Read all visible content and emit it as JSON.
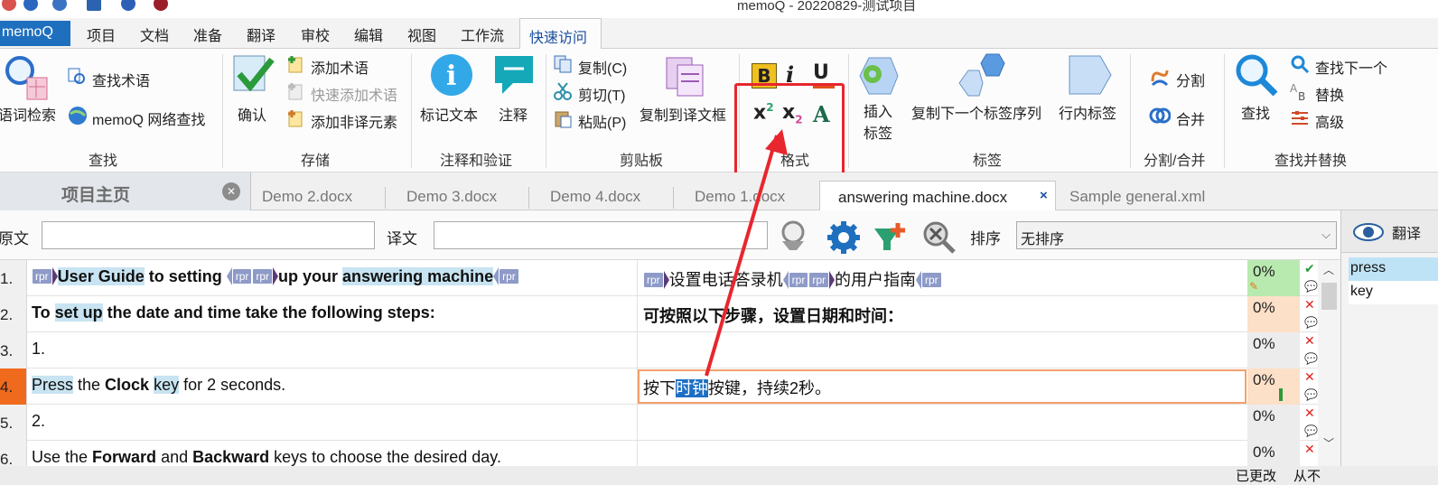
{
  "window": {
    "title": "memoQ - 20220829-测试项目"
  },
  "menu": {
    "app_button": "memoQ",
    "items": [
      "项目",
      "文档",
      "准备",
      "翻译",
      "审校",
      "编辑",
      "视图",
      "工作流"
    ],
    "active": "快速访问"
  },
  "ribbon": {
    "find": {
      "group": "查找",
      "term_search": "语词检索",
      "find_term": "查找术语",
      "web_search": "memoQ 网络查找"
    },
    "store": {
      "group": "存储",
      "confirm": "确认",
      "add_term": "添加术语",
      "quick_add_term": "快速添加术语",
      "add_nontrans": "添加非译元素"
    },
    "annot": {
      "group": "注释和验证",
      "mark_text": "标记文本",
      "comment": "注释"
    },
    "clipboard": {
      "group": "剪贴板",
      "copy": "复制(C)",
      "cut": "剪切(T)",
      "paste": "粘贴(P)",
      "copy_to_target": "复制到译文框"
    },
    "format": {
      "group": "格式",
      "bold": "B",
      "italic": "i",
      "underline": "U",
      "superscript": "x",
      "superscript_exp": "2",
      "subscript": "x",
      "subscript_exp": "2",
      "clear": "A"
    },
    "tags": {
      "group": "标签",
      "insert_tag_1": "插入",
      "insert_tag_2": "标签",
      "copy_next_tag": "复制下一个标签序列",
      "inline_tag": "行内标签"
    },
    "split": {
      "group": "分割/合并",
      "split": "分割",
      "join": "合并"
    },
    "findrep": {
      "group": "查找并替换",
      "find": "查找",
      "find_next": "查找下一个",
      "replace": "替换",
      "advanced": "高级"
    }
  },
  "colors": {
    "accent": "#1f6fbf",
    "highlight_box": "#e8262d",
    "current_row": "#f06a1e",
    "term": "#c8e4f2",
    "tag": "#8e9ac8"
  },
  "tabs": {
    "home": "项目主页",
    "docs": [
      "Demo 2.docx",
      "Demo 3.docx",
      "Demo 4.docx",
      "Demo 1.docx"
    ],
    "active": "answering machine.docx",
    "active_close": "×",
    "last": "Sample general.xml"
  },
  "filter": {
    "source_label": "原文",
    "target_label": "译文",
    "sort_label": "排序",
    "sort_value": "无排序"
  },
  "rows": [
    {
      "num": "1.",
      "pct": "0%"
    },
    {
      "num": "2.",
      "src": "To set up the date and time take the following steps:",
      "tgt": "可按照以下步骤，设置日期和时间：",
      "pct": "0%"
    },
    {
      "num": "3.",
      "src": "1.",
      "pct": "0%"
    },
    {
      "num": "4.",
      "pct": "0%"
    },
    {
      "num": "5.",
      "src": "2.",
      "pct": "0%"
    },
    {
      "num": "6.",
      "src": "Use the Forward and Backward keys to choose the desired day.",
      "pct": "0%"
    }
  ],
  "row1": {
    "src_a": "User Guide",
    "src_b": " to setting ",
    "src_c": "up your ",
    "src_d": "answering machine",
    "tgt_a": "设置电话答录机",
    "tgt_b": "的用户指南",
    "tag": "rpr"
  },
  "row2": {
    "a": "To ",
    "b": "set up",
    "c": " the date and time take the following steps:"
  },
  "row4": {
    "src_a": "Press",
    "src_b": " the ",
    "src_c": "Clock",
    "src_d": " ",
    "src_e": "key",
    "src_f": " for 2 seconds.",
    "tgt_a": "按下",
    "tgt_b": "时钟",
    "tgt_c": "按键，持续2秒。"
  },
  "row6": {
    "a": "Use the ",
    "b": "Forward",
    "c": " and ",
    "d": "Backward",
    "e": " keys to choose the desired day."
  },
  "right_panel": {
    "title": "翻译",
    "items": [
      "press",
      "key"
    ]
  },
  "status": {
    "changed": "已更改",
    "from": "从不"
  }
}
